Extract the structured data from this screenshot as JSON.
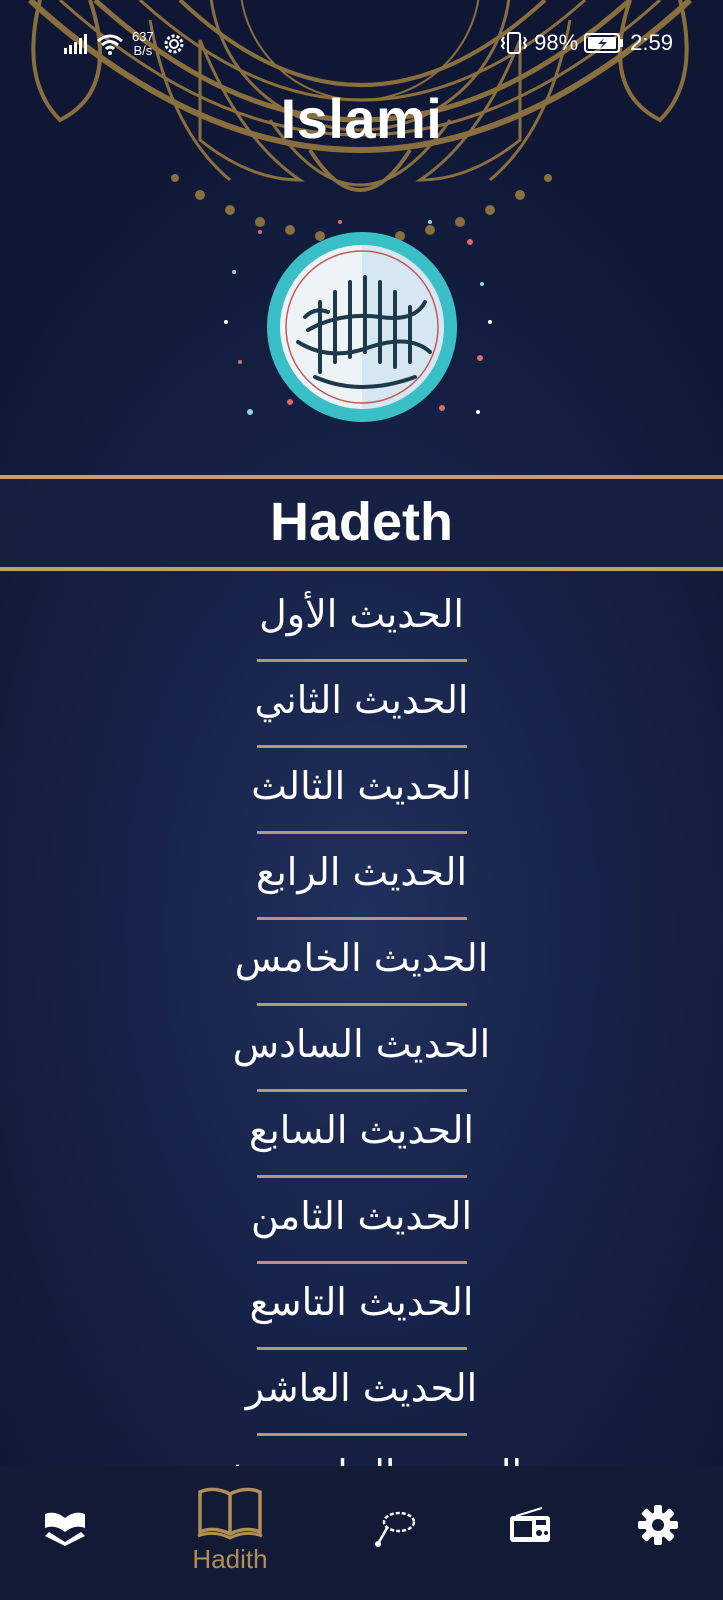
{
  "status_bar": {
    "net_speed_value": "637",
    "net_speed_unit": "B/s",
    "battery": "98%",
    "time": "2:59"
  },
  "app": {
    "title": "Islami"
  },
  "section": {
    "title": "Hadeth"
  },
  "hadith_list": [
    "الحديث الأول",
    "الحديث الثاني",
    "الحديث الثالث",
    "الحديث الرابع",
    "الحديث الخامس",
    "الحديث السادس",
    "الحديث السابع",
    "الحديث الثامن",
    "الحديث التاسع",
    "الحديث العاشر",
    "الحديث الحادي عشر"
  ],
  "bottom_nav": {
    "active_label": "Hadith",
    "items": [
      "quran-icon",
      "hadith-book-icon",
      "sebha-icon",
      "radio-icon",
      "settings-icon"
    ]
  },
  "colors": {
    "accent_gold": "#b89a6a",
    "background_dark": "#0f1734",
    "background_mid": "#20305c"
  }
}
